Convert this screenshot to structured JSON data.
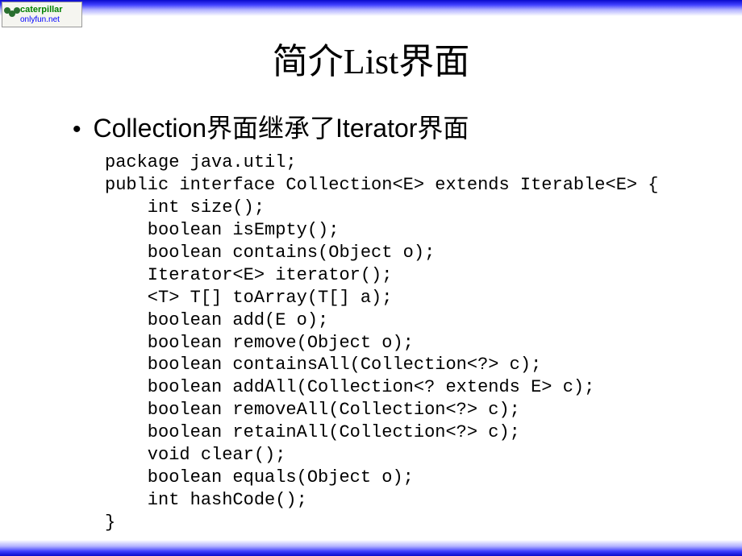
{
  "logo": {
    "text1": "caterpillar",
    "text2": "onlyfun.net"
  },
  "title": "简介List界面",
  "bullet": "Collection界面继承了Iterator界面",
  "code": "package java.util;\npublic interface Collection<E> extends Iterable<E> {\n    int size();\n    boolean isEmpty();\n    boolean contains(Object o);\n    Iterator<E> iterator();\n    <T> T[] toArray(T[] a);\n    boolean add(E o);\n    boolean remove(Object o);\n    boolean containsAll(Collection<?> c);\n    boolean addAll(Collection<? extends E> c);\n    boolean removeAll(Collection<?> c);\n    boolean retainAll(Collection<?> c);\n    void clear();\n    boolean equals(Object o);\n    int hashCode();\n}"
}
